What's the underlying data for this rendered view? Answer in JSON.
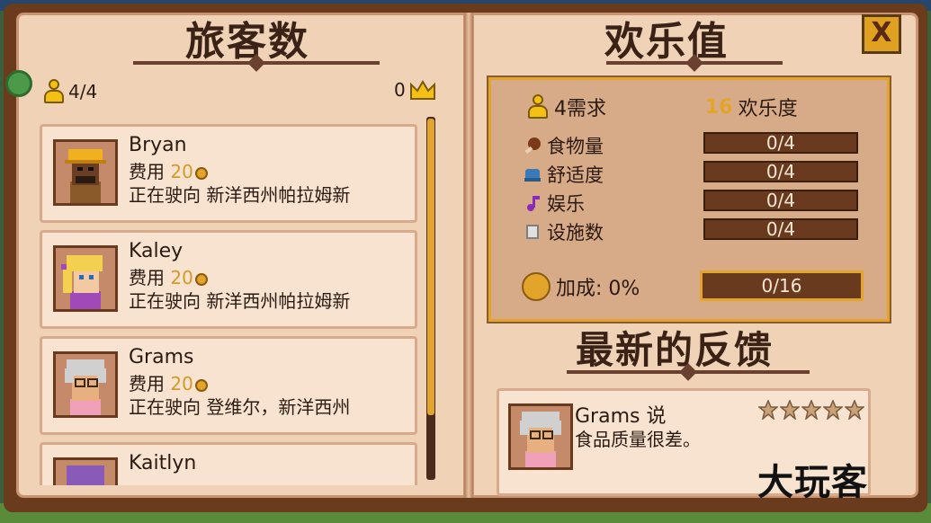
{
  "left_page": {
    "title": "旅客数",
    "guest_count": "4/4",
    "crown_count": "0",
    "guests": [
      {
        "name": "Bryan",
        "fee_label": "费用",
        "fee": "20",
        "status": "正在驶向 新洋西州帕拉姆新"
      },
      {
        "name": "Kaley",
        "fee_label": "费用",
        "fee": "20",
        "status": "正在驶向 新洋西州帕拉姆新"
      },
      {
        "name": "Grams",
        "fee_label": "费用",
        "fee": "20",
        "status": "正在驶向 登维尔，新洋西州"
      },
      {
        "name": "Kaitlyn",
        "fee_label": "",
        "fee": "",
        "status": ""
      }
    ]
  },
  "right_page": {
    "title": "欢乐值",
    "needs_summary": "4需求",
    "happiness_value": "16",
    "happiness_label": "欢乐度",
    "needs": [
      {
        "icon": "food-icon",
        "label": "食物量",
        "value": "0/4",
        "color": "#7a3a1a"
      },
      {
        "icon": "comfort-icon",
        "label": "舒适度",
        "value": "0/4",
        "color": "#3a7ab8"
      },
      {
        "icon": "music-icon",
        "label": "娱乐",
        "value": "0/4",
        "color": "#8a2ab8"
      },
      {
        "icon": "cup-icon",
        "label": "设施数",
        "value": "0/4",
        "color": "#c0c0c0"
      }
    ],
    "bonus_label": "加成: 0%",
    "total": "0/16",
    "feedback_title": "最新的反馈",
    "feedback": {
      "author": "Grams 说",
      "text": "食品质量很差。",
      "stars": 5
    }
  },
  "close_label": "X",
  "watermark": "大玩客",
  "colors": {
    "accent": "#e2a42a",
    "page": "#f0d3b7",
    "cover": "#6b3b1e"
  }
}
